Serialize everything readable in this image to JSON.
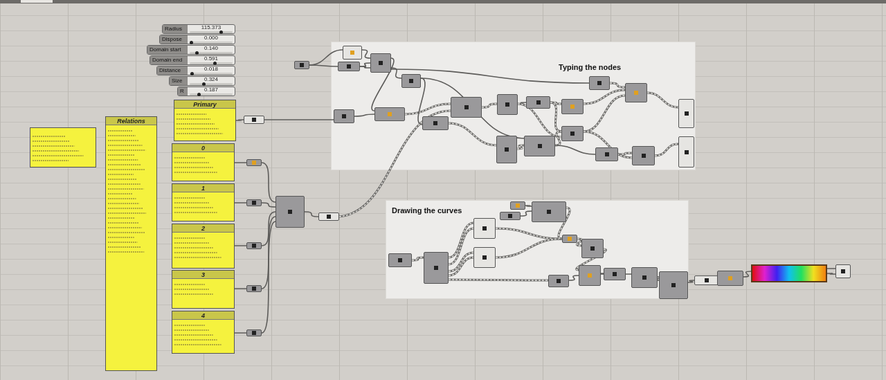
{
  "sliders": [
    {
      "label": "Radius",
      "value": "115.373",
      "level": 0.75
    },
    {
      "label": "Dispose",
      "value": "0.000",
      "level": 0.0
    },
    {
      "label": "Domain start",
      "value": "0.140",
      "level": 0.14
    },
    {
      "label": "Domain end",
      "value": "0.591",
      "level": 0.59
    },
    {
      "label": "Distance",
      "value": "0.018",
      "level": 0.02
    },
    {
      "label": "Size",
      "value": "0.324",
      "level": 0.32
    },
    {
      "label": "R",
      "value": "0.187",
      "level": 0.19
    }
  ],
  "panels": [
    {
      "title": "Relations"
    },
    {
      "title": "Primary"
    },
    {
      "title": "0"
    },
    {
      "title": "1"
    },
    {
      "title": "2"
    },
    {
      "title": "3"
    },
    {
      "title": "4"
    }
  ],
  "groups": [
    {
      "title": "Typing the nodes"
    },
    {
      "title": "Drawing the curves"
    }
  ]
}
